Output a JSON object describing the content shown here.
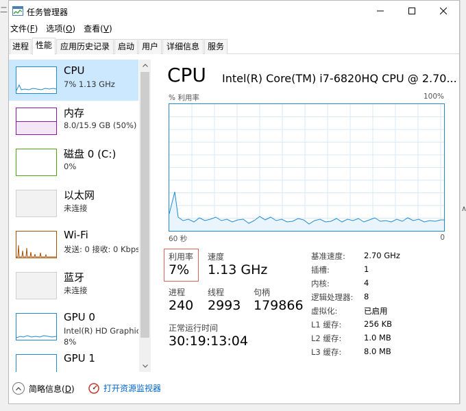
{
  "window": {
    "title": "任务管理器",
    "left_fragment": "二",
    "right_fragment": "∧"
  },
  "menu": [
    {
      "label": "文件(",
      "key": "F",
      "end": ")"
    },
    {
      "label": "选项(",
      "key": "O",
      "end": ")"
    },
    {
      "label": "查看(",
      "key": "V",
      "end": ")"
    }
  ],
  "tabs": [
    "进程",
    "性能",
    "应用历史记录",
    "启动",
    "用户",
    "详细信息",
    "服务"
  ],
  "active_tab": "性能",
  "sidebar": [
    {
      "title": "CPU",
      "sub": "7% 1.13 GHz",
      "color": "#1f8ad2"
    },
    {
      "title": "内存",
      "sub": "8.0/15.9 GB (50%)",
      "color": "#8b12ae"
    },
    {
      "title": "磁盘 0 (C:)",
      "sub": "0%",
      "color": "#4da60c"
    },
    {
      "title": "以太网",
      "sub": "未连接",
      "color": "#a4a4a4"
    },
    {
      "title": "Wi-Fi",
      "sub": "发送: 0 接收: 0 Kbps",
      "color": "#a74f01"
    },
    {
      "title": "蓝牙",
      "sub": "未连接",
      "color": "#a4a4a4"
    },
    {
      "title": "GPU 0",
      "sub": "Intel(R) HD Graphics",
      "sub2": "8%",
      "color": "#1f8ad2"
    },
    {
      "title": "GPU 1",
      "sub": "",
      "color": "#1f8ad2"
    }
  ],
  "cpu": {
    "title": "CPU",
    "model": "Intel(R) Core(TM) i7-6820HQ CPU @ 2.70...",
    "graph_label": "% 利用率",
    "graph_max": "100%",
    "axis_left": "60 秒",
    "axis_right": "0",
    "util_label": "利用率",
    "util_value": "7%",
    "speed_label": "速度",
    "speed_value": "1.13 GHz",
    "proc_label": "进程",
    "proc_value": "240",
    "threads_label": "线程",
    "threads_value": "2993",
    "handles_label": "句柄",
    "handles_value": "179866",
    "uptime_label": "正常运行时间",
    "uptime_value": "30:19:13:04"
  },
  "specs": [
    {
      "label": "基准速度:",
      "value": "2.70 GHz"
    },
    {
      "label": "插槽:",
      "value": "1"
    },
    {
      "label": "内核:",
      "value": "4"
    },
    {
      "label": "逻辑处理器:",
      "value": "8"
    },
    {
      "label": "虚拟化:",
      "value": "已启用"
    },
    {
      "label": "L1 缓存:",
      "value": "256 KB"
    },
    {
      "label": "L2 缓存:",
      "value": "1.0 MB"
    },
    {
      "label": "L3 缓存:",
      "value": "8.0 MB"
    }
  ],
  "footer": {
    "brief_label": "简略信息(",
    "brief_key": "D",
    "brief_end": ")",
    "monitor_label": "打开资源监视器"
  },
  "colors": {
    "cpu_accent": "#1f8ad2",
    "selected_bg": "#cce8ff",
    "util_box": "#e06060"
  }
}
